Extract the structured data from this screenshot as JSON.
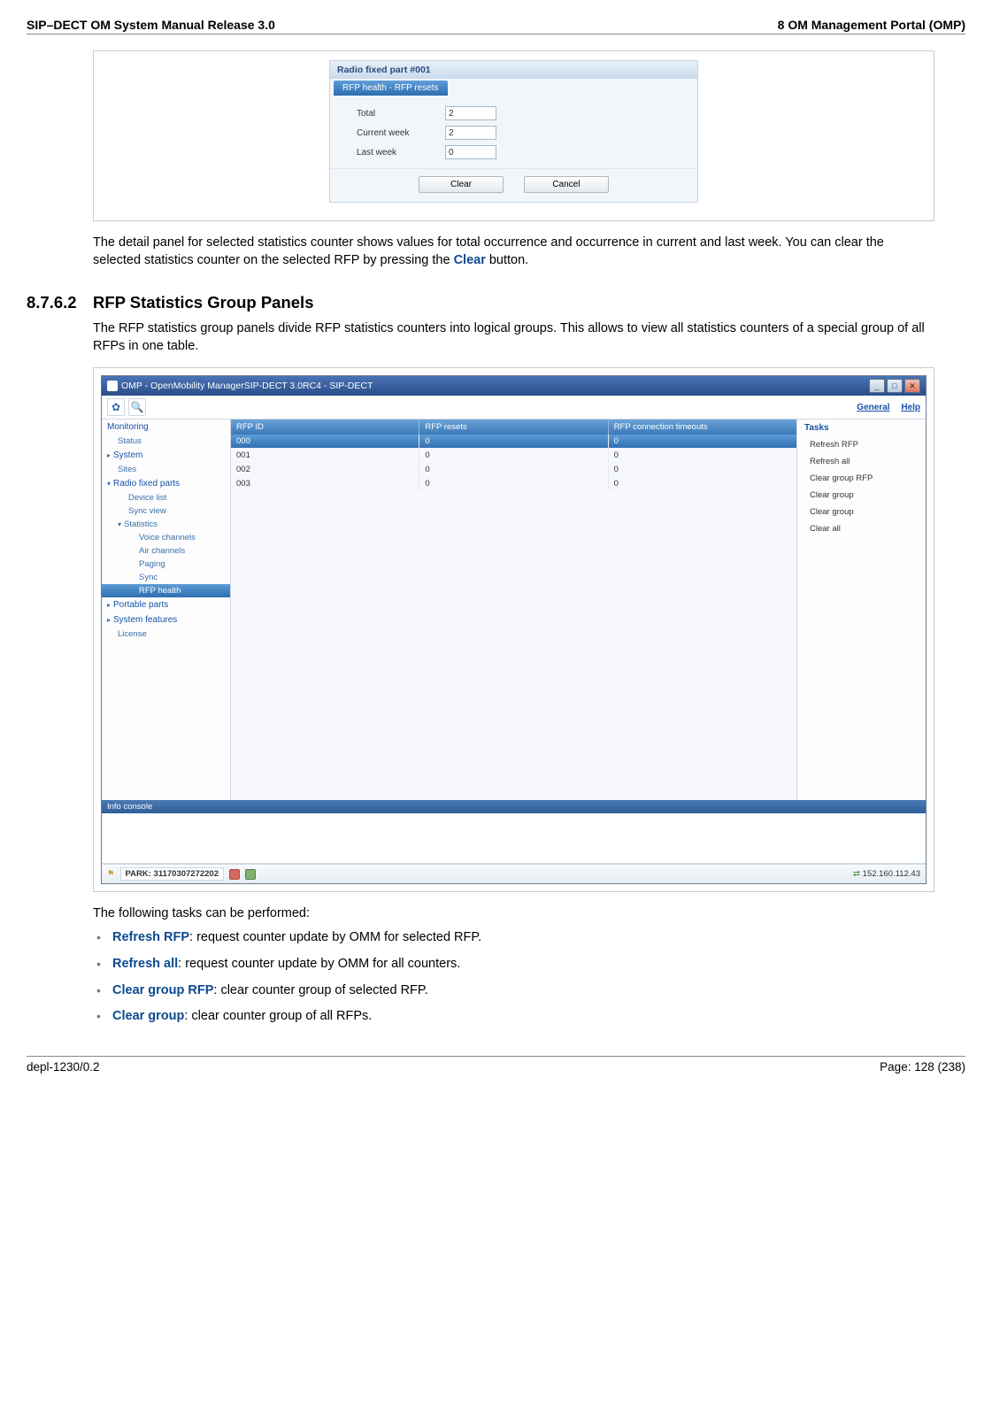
{
  "header": {
    "left": "SIP–DECT OM System Manual Release 3.0",
    "right": "8 OM Management Portal (OMP)"
  },
  "dialog1": {
    "title": "Radio fixed part #001",
    "tab": "RFP health - RFP resets",
    "rows": [
      {
        "label": "Total",
        "value": "2"
      },
      {
        "label": "Current week",
        "value": "2"
      },
      {
        "label": "Last week",
        "value": "0"
      }
    ],
    "buttons": {
      "clear": "Clear",
      "cancel": "Cancel"
    }
  },
  "para1a": "The detail panel for selected statistics counter shows values for total occurrence and occurrence in current and last week. You can clear the selected statistics counter on the selected RFP by pressing the ",
  "para1b": "Clear",
  "para1c": " button.",
  "section": {
    "num": "8.7.6.2",
    "title": "RFP Statistics Group Panels"
  },
  "para2": "The RFP statistics group panels divide RFP statistics counters into logical groups. This allows to view all statistics counters of a special group of all RFPs in one table.",
  "omp": {
    "title": "OMP - OpenMobility ManagerSIP-DECT 3.0RC4 - SIP-DECT",
    "toplinks": {
      "general": "General",
      "help": "Help"
    },
    "sidebar": {
      "monitoring": "Monitoring",
      "status": "Status",
      "system": "System",
      "sites": "Sites",
      "rfp": "Radio fixed parts",
      "devicelist": "Device list",
      "syncview": "Sync view",
      "statistics": "Statistics",
      "voice": "Voice channels",
      "air": "Air channels",
      "paging": "Paging",
      "sync": "Sync",
      "rfphealth": "RFP health",
      "portable": "Portable parts",
      "sysfeat": "System features",
      "license": "License"
    },
    "table": {
      "headers": {
        "c1": "RFP ID",
        "c2": "RFP resets",
        "c3": "RFP connection timeouts"
      },
      "rows": [
        {
          "c1": "000",
          "c2": "0",
          "c3": "0"
        },
        {
          "c1": "001",
          "c2": "0",
          "c3": "0"
        },
        {
          "c1": "002",
          "c2": "0",
          "c3": "0"
        },
        {
          "c1": "003",
          "c2": "0",
          "c3": "0"
        }
      ]
    },
    "tasks": {
      "title": "Tasks",
      "items": [
        "Refresh RFP",
        "Refresh all",
        "Clear group RFP",
        "Clear group",
        "Clear group",
        "Clear all"
      ]
    },
    "infoconsole": "Info console",
    "statusbar": {
      "park": "PARK: 31170307272202",
      "ip": "152.160.112.43"
    }
  },
  "para3": "The following tasks can be performed:",
  "bullets": [
    {
      "b": "Refresh RFP",
      "t": ": request counter update by OMM for selected RFP."
    },
    {
      "b": "Refresh all",
      "t": ": request counter update by OMM for all counters."
    },
    {
      "b": "Clear group RFP",
      "t": ": clear counter group of selected RFP."
    },
    {
      "b": "Clear group",
      "t": ": clear counter group of all RFPs."
    }
  ],
  "footer": {
    "left": "depl-1230/0.2",
    "right": "Page: 128 (238)"
  }
}
